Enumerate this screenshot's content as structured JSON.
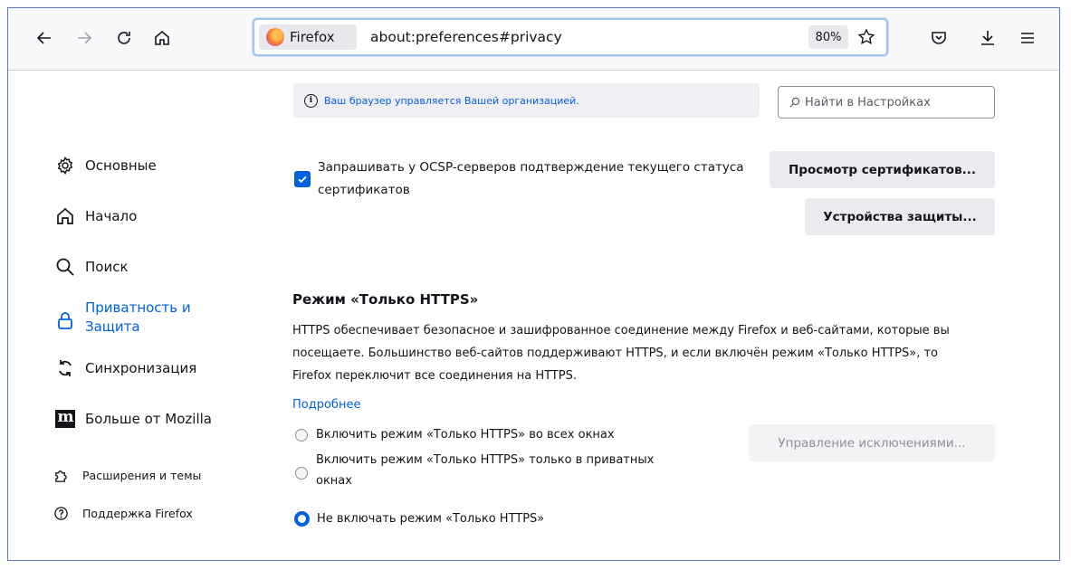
{
  "toolbar": {
    "identity_label": "Firefox",
    "url": "about:preferences#privacy",
    "zoom": "80%",
    "icons": [
      "back-icon",
      "forward-icon",
      "reload-icon",
      "home-icon",
      "bookmark-star-icon",
      "pocket-icon",
      "download-icon",
      "menu-icon"
    ]
  },
  "sidebar": {
    "items": [
      {
        "label": "Основные",
        "icon": "gear-icon"
      },
      {
        "label": "Начало",
        "icon": "home-icon"
      },
      {
        "label": "Поиск",
        "icon": "search-icon"
      },
      {
        "label_line1": "Приватность и",
        "label_line2": "Защита",
        "icon": "lock-icon"
      },
      {
        "label": "Синхронизация",
        "icon": "sync-icon"
      },
      {
        "label": "Больше от Mozilla",
        "icon": "mozilla-m-icon",
        "logo_text": "m"
      }
    ],
    "footer": [
      {
        "label": "Расширения и темы",
        "icon": "puzzle-icon"
      },
      {
        "label": "Поддержка Firefox",
        "icon": "help-icon"
      }
    ]
  },
  "policy_notice": "Ваш браузер управляется Вашей организацией.",
  "search": {
    "placeholder": "Найти в Настройках"
  },
  "certificates": {
    "ocsp_label": "Запрашивать у OCSP-серверов подтверждение текущего статуса сертификатов",
    "ocsp_checked": true,
    "view_certificates_button": "Просмотр сертификатов...",
    "security_devices_button": "Устройства защиты..."
  },
  "https_only": {
    "title": "Режим «Только HTTPS»",
    "description": "HTTPS обеспечивает безопасное и зашифрованное соединение между Firefox и веб-сайтами, которые вы посещаете. Большинство веб-сайтов поддерживают HTTPS, и если включён режим «Только HTTPS», то Firefox переключит все соединения на HTTPS.",
    "learn_more": "Подробнее",
    "manage_exceptions_button": "Управление исключениями...",
    "options": [
      {
        "label": "Включить режим «Только HTTPS» во всех окнах",
        "selected": false
      },
      {
        "label_line1": "Включить режим «Только HTTPS» только в приватных",
        "label_line2": "окнах",
        "selected": false
      },
      {
        "label": "Не включать режим «Только HTTPS»",
        "selected": true
      }
    ]
  },
  "colors": {
    "accent": "#0061e0",
    "urlbar_focus": "#9fc2ee",
    "button_bg": "#ebebef"
  }
}
